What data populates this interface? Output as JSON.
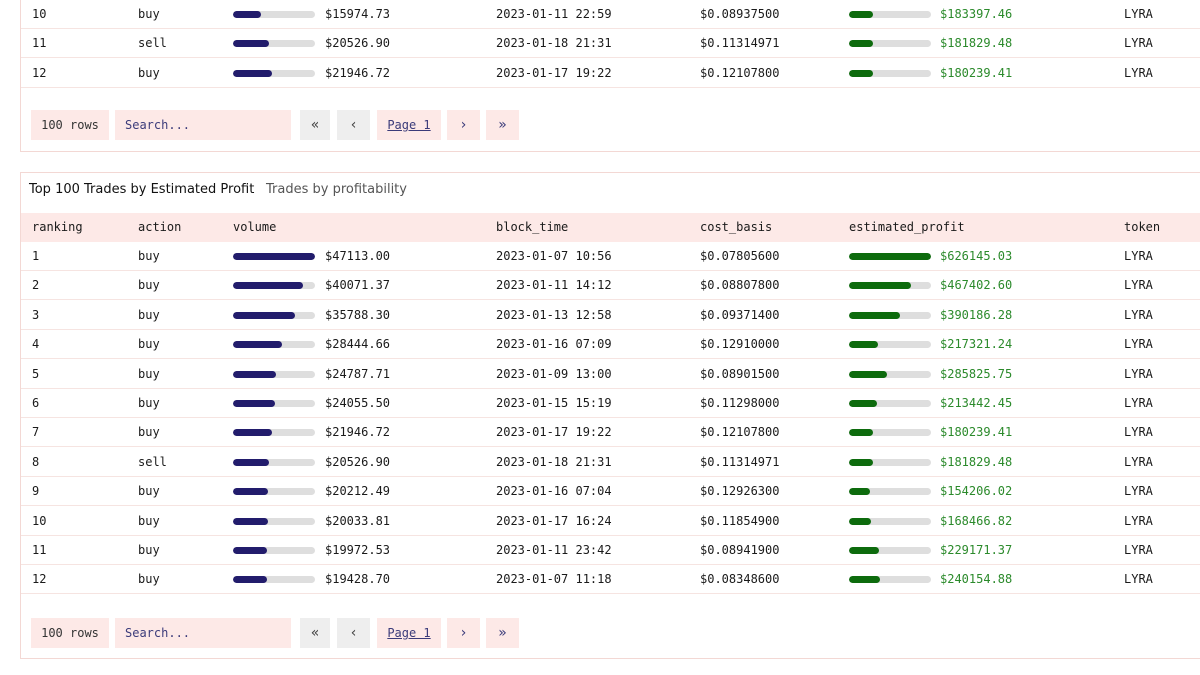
{
  "table1": {
    "rows": [
      {
        "ranking": "10",
        "action": "buy",
        "volume": "$15974.73",
        "volume_fraction": 0.34,
        "block_time": "2023-01-11 22:59",
        "cost_basis": "$0.08937500",
        "estimated_profit": "$183397.46",
        "profit_fraction": 0.29,
        "token": "LYRA"
      },
      {
        "ranking": "11",
        "action": "sell",
        "volume": "$20526.90",
        "volume_fraction": 0.44,
        "block_time": "2023-01-18 21:31",
        "cost_basis": "$0.11314971",
        "estimated_profit": "$181829.48",
        "profit_fraction": 0.29,
        "token": "LYRA"
      },
      {
        "ranking": "12",
        "action": "buy",
        "volume": "$21946.72",
        "volume_fraction": 0.47,
        "block_time": "2023-01-17 19:22",
        "cost_basis": "$0.12107800",
        "estimated_profit": "$180239.41",
        "profit_fraction": 0.29,
        "token": "LYRA"
      }
    ],
    "controls": {
      "rows_label": "100 rows",
      "search_placeholder": "Search...",
      "page_label": "Page 1"
    }
  },
  "table2": {
    "title": "Top 100 Trades by Estimated Profit",
    "subtitle": "Trades by profitability",
    "columns": {
      "ranking": "ranking",
      "action": "action",
      "volume": "volume",
      "block_time": "block_time",
      "cost_basis": "cost_basis",
      "estimated_profit": "estimated_profit",
      "token": "token"
    },
    "rows": [
      {
        "ranking": "1",
        "action": "buy",
        "volume": "$47113.00",
        "volume_fraction": 1.0,
        "block_time": "2023-01-07 10:56",
        "cost_basis": "$0.07805600",
        "estimated_profit": "$626145.03",
        "profit_fraction": 1.0,
        "token": "LYRA"
      },
      {
        "ranking": "2",
        "action": "buy",
        "volume": "$40071.37",
        "volume_fraction": 0.85,
        "block_time": "2023-01-11 14:12",
        "cost_basis": "$0.08807800",
        "estimated_profit": "$467402.60",
        "profit_fraction": 0.75,
        "token": "LYRA"
      },
      {
        "ranking": "3",
        "action": "buy",
        "volume": "$35788.30",
        "volume_fraction": 0.76,
        "block_time": "2023-01-13 12:58",
        "cost_basis": "$0.09371400",
        "estimated_profit": "$390186.28",
        "profit_fraction": 0.62,
        "token": "LYRA"
      },
      {
        "ranking": "4",
        "action": "buy",
        "volume": "$28444.66",
        "volume_fraction": 0.6,
        "block_time": "2023-01-16 07:09",
        "cost_basis": "$0.12910000",
        "estimated_profit": "$217321.24",
        "profit_fraction": 0.35,
        "token": "LYRA"
      },
      {
        "ranking": "5",
        "action": "buy",
        "volume": "$24787.71",
        "volume_fraction": 0.53,
        "block_time": "2023-01-09 13:00",
        "cost_basis": "$0.08901500",
        "estimated_profit": "$285825.75",
        "profit_fraction": 0.46,
        "token": "LYRA"
      },
      {
        "ranking": "6",
        "action": "buy",
        "volume": "$24055.50",
        "volume_fraction": 0.51,
        "block_time": "2023-01-15 15:19",
        "cost_basis": "$0.11298000",
        "estimated_profit": "$213442.45",
        "profit_fraction": 0.34,
        "token": "LYRA"
      },
      {
        "ranking": "7",
        "action": "buy",
        "volume": "$21946.72",
        "volume_fraction": 0.47,
        "block_time": "2023-01-17 19:22",
        "cost_basis": "$0.12107800",
        "estimated_profit": "$180239.41",
        "profit_fraction": 0.29,
        "token": "LYRA"
      },
      {
        "ranking": "8",
        "action": "sell",
        "volume": "$20526.90",
        "volume_fraction": 0.44,
        "block_time": "2023-01-18 21:31",
        "cost_basis": "$0.11314971",
        "estimated_profit": "$181829.48",
        "profit_fraction": 0.29,
        "token": "LYRA"
      },
      {
        "ranking": "9",
        "action": "buy",
        "volume": "$20212.49",
        "volume_fraction": 0.43,
        "block_time": "2023-01-16 07:04",
        "cost_basis": "$0.12926300",
        "estimated_profit": "$154206.02",
        "profit_fraction": 0.25,
        "token": "LYRA"
      },
      {
        "ranking": "10",
        "action": "buy",
        "volume": "$20033.81",
        "volume_fraction": 0.43,
        "block_time": "2023-01-17 16:24",
        "cost_basis": "$0.11854900",
        "estimated_profit": "$168466.82",
        "profit_fraction": 0.27,
        "token": "LYRA"
      },
      {
        "ranking": "11",
        "action": "buy",
        "volume": "$19972.53",
        "volume_fraction": 0.42,
        "block_time": "2023-01-11 23:42",
        "cost_basis": "$0.08941900",
        "estimated_profit": "$229171.37",
        "profit_fraction": 0.37,
        "token": "LYRA"
      },
      {
        "ranking": "12",
        "action": "buy",
        "volume": "$19428.70",
        "volume_fraction": 0.41,
        "block_time": "2023-01-07 11:18",
        "cost_basis": "$0.08348600",
        "estimated_profit": "$240154.88",
        "profit_fraction": 0.38,
        "token": "LYRA"
      }
    ],
    "controls": {
      "rows_label": "100 rows",
      "search_placeholder": "Search...",
      "page_label": "Page 1"
    }
  },
  "icons": {
    "first": "double-chevron-left-icon",
    "prev": "chevron-left-icon",
    "next": "chevron-right-icon",
    "last": "double-chevron-right-icon"
  },
  "colors": {
    "volume_bar": "#221c6c",
    "profit_bar": "#0d6b0d",
    "profit_text": "#2b8a2b",
    "header_bg": "#fde9e7"
  }
}
